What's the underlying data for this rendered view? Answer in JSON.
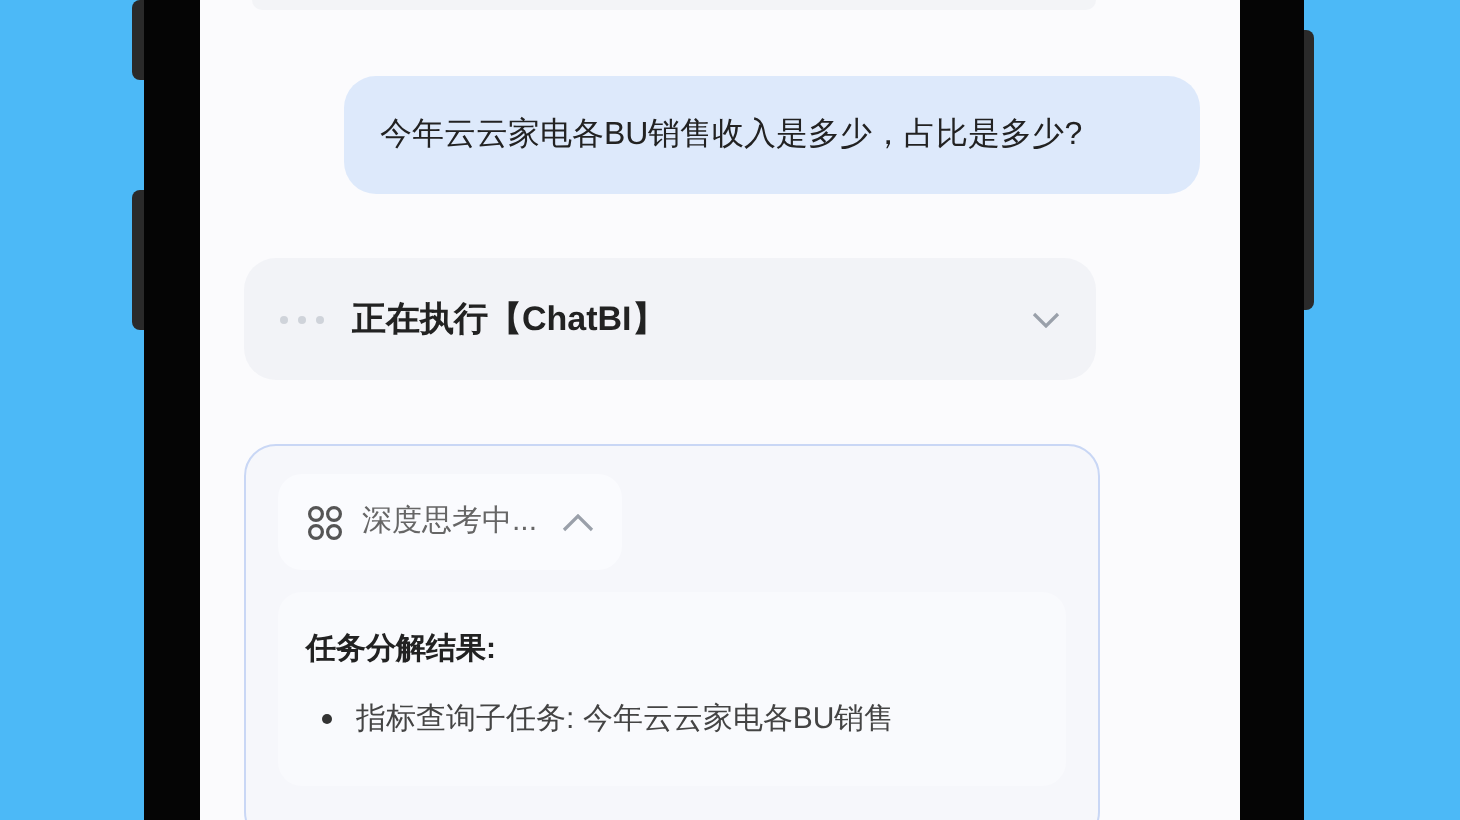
{
  "user_message": {
    "text": "今年云云家电各BU销售收入是多少，占比是多少?"
  },
  "status": {
    "text": "正在执行【ChatBI】",
    "expanded": false
  },
  "thinking": {
    "label": "深度思考中...",
    "expanded": true,
    "heading": "任务分解结果:",
    "items": [
      "指标查询子任务: 今年云云家电各BU销售"
    ]
  }
}
